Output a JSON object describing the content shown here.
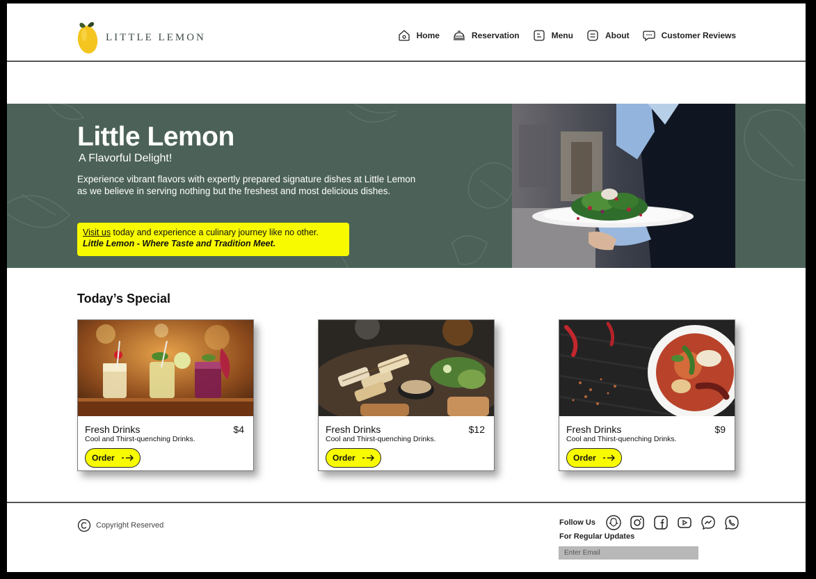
{
  "header": {
    "brand": "LITTLE LEMON",
    "nav": [
      {
        "label": "Home",
        "icon": "home-icon"
      },
      {
        "label": "Reservation",
        "icon": "reservation-icon"
      },
      {
        "label": "Menu",
        "icon": "menu-icon"
      },
      {
        "label": "About",
        "icon": "about-icon"
      },
      {
        "label": "Customer Reviews",
        "icon": "chat-icon"
      }
    ]
  },
  "hero": {
    "title": "Little Lemon",
    "subtitle": "A Flavorful Delight!",
    "description": "Experience vibrant flavors with expertly prepared signature dishes at Little Lemon as we believe in serving nothing but the freshest and most delicious dishes.",
    "callout_link": "Visit us",
    "callout_text": " today and experience a culinary journey like no other.",
    "callout_tagline": "Little Lemon - Where Taste and Tradition Meet.",
    "background_color": "#4c6258",
    "callout_color": "#f8fb00"
  },
  "specials": {
    "title": "Today’s Special",
    "cards": [
      {
        "name": "Fresh Drinks",
        "price": "$4",
        "description": "Cool and Thirst-quenching Drinks.",
        "button": "Order",
        "image": "cocktails-image"
      },
      {
        "name": "Fresh Drinks",
        "price": "$12",
        "description": "Cool and Thirst-quenching Drinks.",
        "button": "Order",
        "image": "grilled-platter-image"
      },
      {
        "name": "Fresh Drinks",
        "price": "$9",
        "description": "Cool and Thirst-quenching Drinks.",
        "button": "Order",
        "image": "curry-bowl-image"
      }
    ]
  },
  "footer": {
    "copyright": "Copyright Reserved",
    "follow_label": "Follow Us",
    "social": [
      "snapchat-icon",
      "instagram-icon",
      "facebook-icon",
      "youtube-icon",
      "messenger-icon",
      "whatsapp-icon"
    ],
    "updates_label": "For Regular Updates",
    "email_placeholder": "Enter Email"
  }
}
